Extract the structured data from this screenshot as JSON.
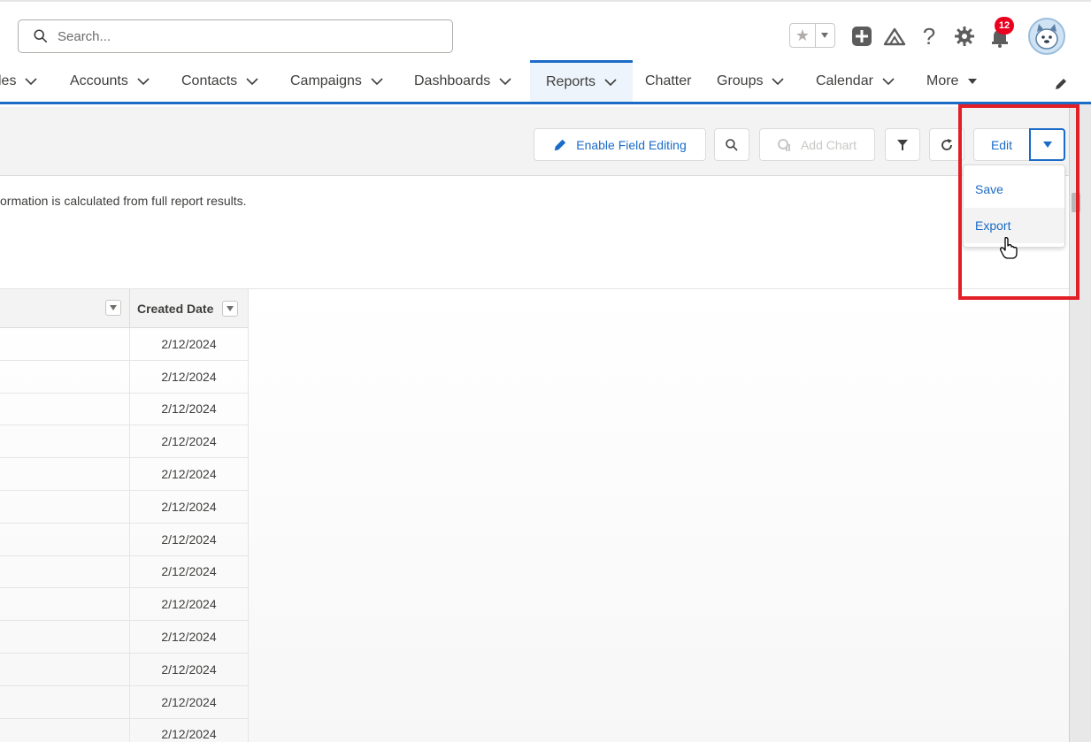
{
  "header": {
    "search_placeholder": "Search...",
    "notification_count": "12",
    "icons": [
      "search-icon",
      "star-icon",
      "caret-down-icon",
      "add-icon",
      "trailhead-icon",
      "help-icon",
      "gear-icon",
      "bell-icon",
      "avatar"
    ]
  },
  "nav": {
    "items": [
      {
        "label": "les"
      },
      {
        "label": "Accounts"
      },
      {
        "label": "Contacts"
      },
      {
        "label": "Campaigns"
      },
      {
        "label": "Dashboards"
      },
      {
        "label": "Reports"
      },
      {
        "label": "Chatter"
      },
      {
        "label": "Groups"
      },
      {
        "label": "Calendar"
      },
      {
        "label": "More"
      }
    ],
    "active": "Reports"
  },
  "toolbar": {
    "enable_field_editing": "Enable Field Editing",
    "add_chart": "Add Chart",
    "edit": "Edit"
  },
  "dropdown": {
    "items": [
      {
        "label": "Save"
      },
      {
        "label": "Export"
      }
    ]
  },
  "info": {
    "text": "ormation is calculated from full report results."
  },
  "table": {
    "columns": [
      "",
      "Created Date"
    ],
    "rows": [
      "2/12/2024",
      "2/12/2024",
      "2/12/2024",
      "2/12/2024",
      "2/12/2024",
      "2/12/2024",
      "2/12/2024",
      "2/12/2024",
      "2/12/2024",
      "2/12/2024",
      "2/12/2024",
      "2/12/2024",
      "2/12/2024"
    ]
  },
  "colors": {
    "brand_blue": "#1b6bc7",
    "highlight_red": "#e21f26",
    "badge_red": "#ea001e"
  }
}
